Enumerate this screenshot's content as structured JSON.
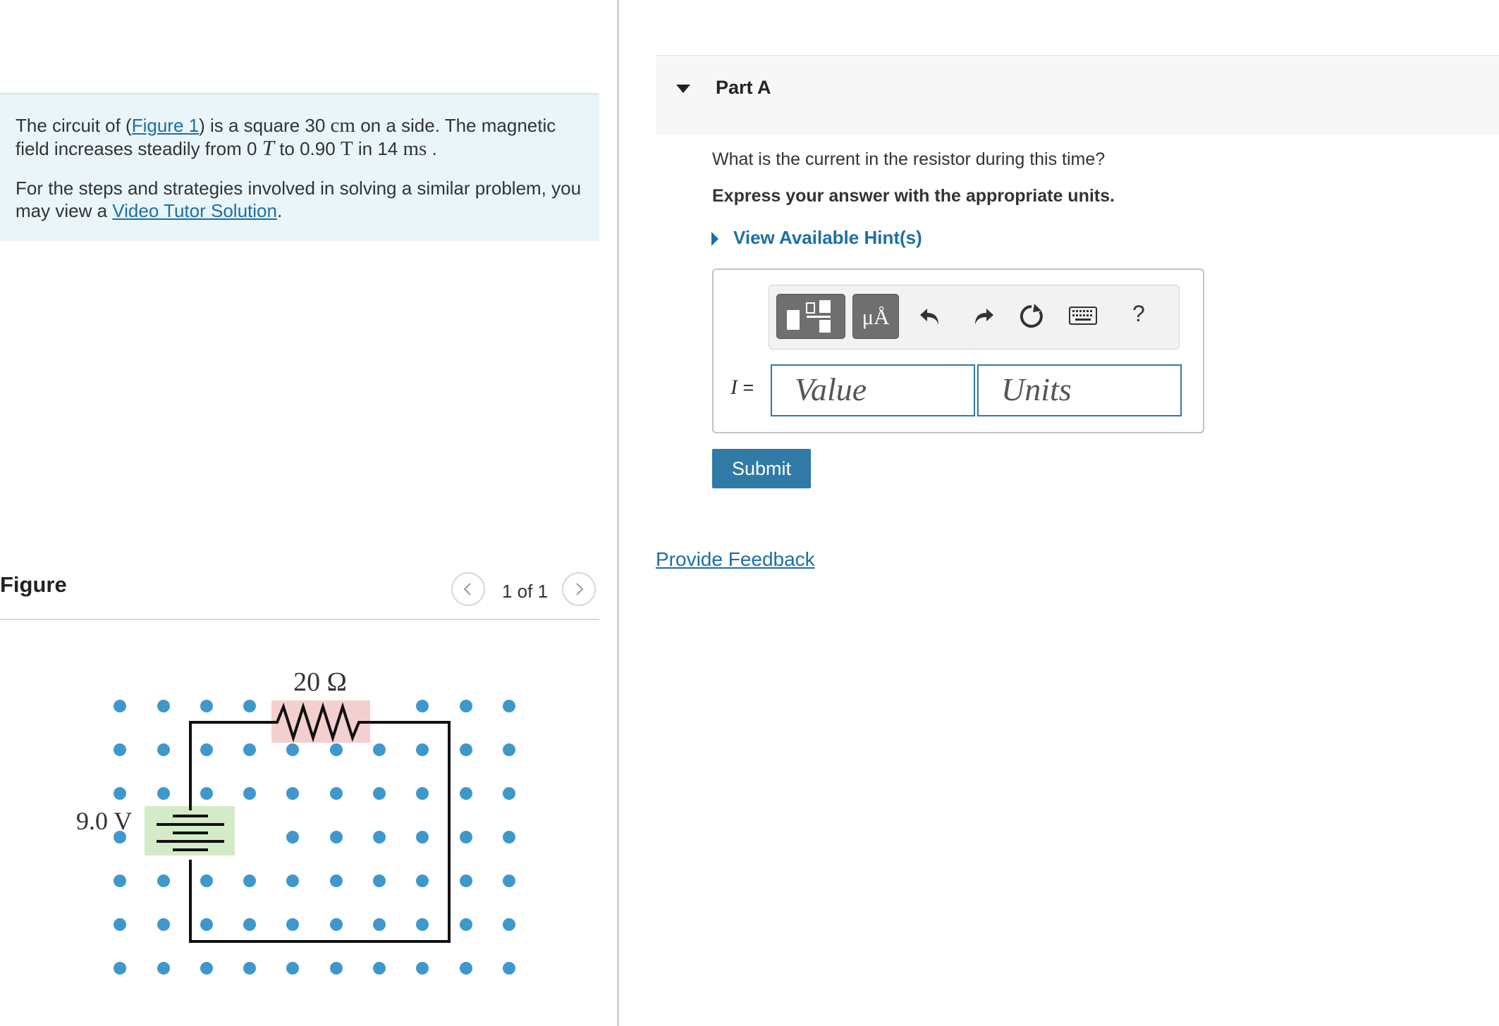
{
  "problem": {
    "p1_before": "The circuit of (",
    "p1_link": "Figure 1",
    "p1_mid1": ") is a square 30 ",
    "p1_unit1": "cm",
    "p1_mid2": " on a side. The magnetic field increases steadily from 0 ",
    "p1_T_italic": "T",
    "p1_mid3": " to 0.90 ",
    "p1_T": "T",
    "p1_mid4": " in 14 ",
    "p1_unit2": "ms",
    "p1_end": " .",
    "p2_before": "For the steps and strategies involved in solving a similar problem, you may view a ",
    "p2_link": "Video Tutor Solution",
    "p2_end": "."
  },
  "figure": {
    "title": "Figure",
    "counter": "1 of 1",
    "resistor_label": "20 Ω",
    "battery_label": "9.0 V",
    "dot_color": "#3f98cc",
    "resistor_bg": "#f4cfcf",
    "battery_bg": "#d3ebc6"
  },
  "part": {
    "title": "Part A",
    "question": "What is the current in the resistor during this time?",
    "instruction": "Express your answer with the appropriate units.",
    "hint_label": "View Available Hint(s)"
  },
  "answer": {
    "variable": "I",
    "equals": " =",
    "value_placeholder": "Value",
    "units_placeholder": "Units",
    "units_tool_label": "μÅ",
    "help_label": "?"
  },
  "submit_label": "Submit",
  "feedback_label": "Provide Feedback",
  "colors": {
    "link": "#1d6fa5",
    "button": "#2f7aa6",
    "problem_bg": "#e9f5f8"
  }
}
